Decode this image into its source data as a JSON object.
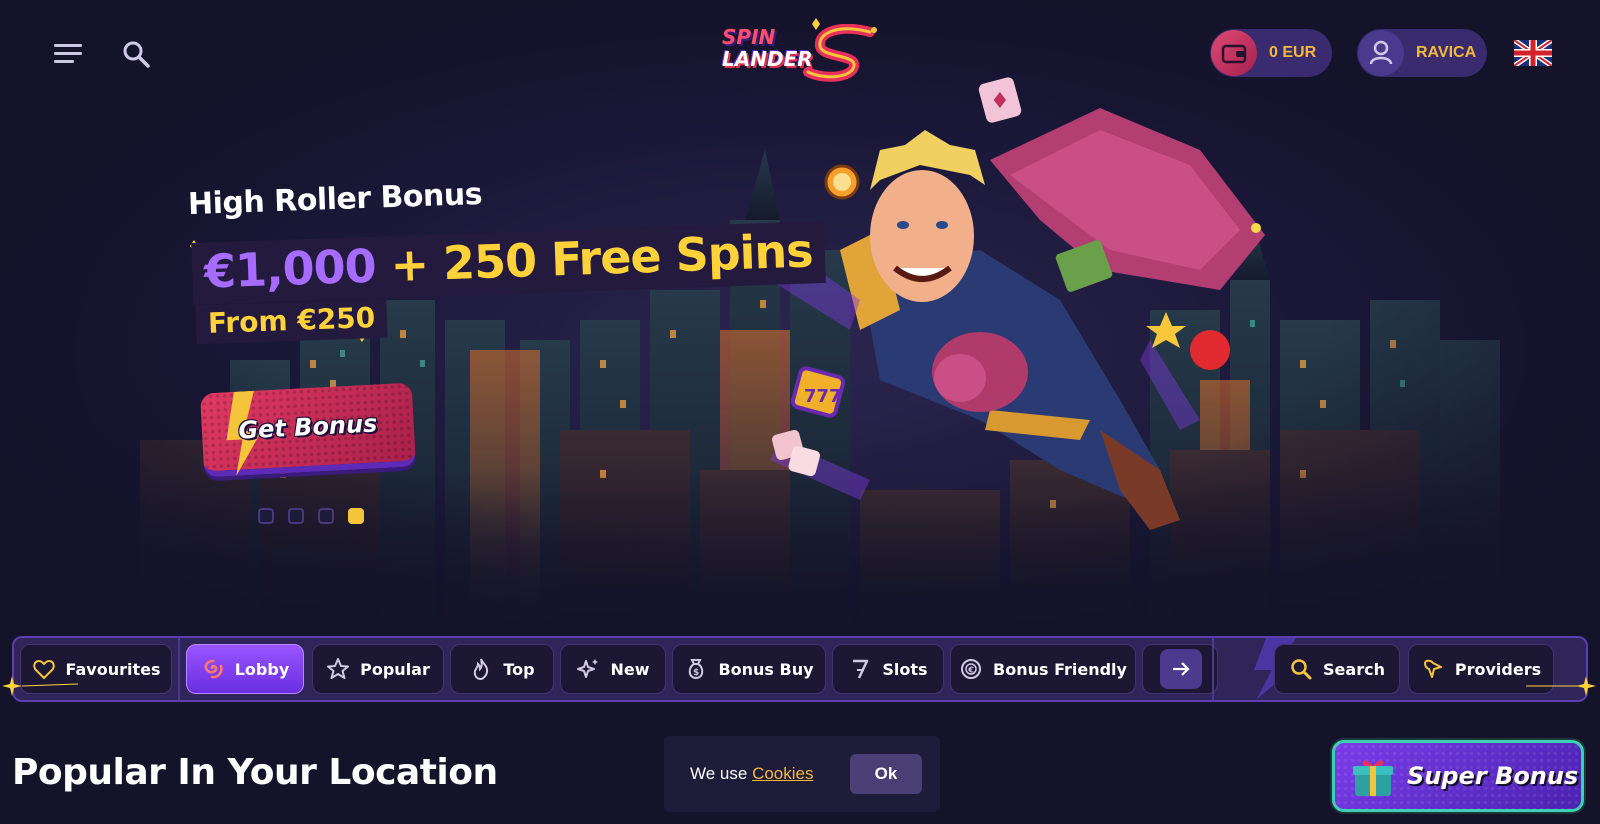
{
  "header": {
    "logo_line1": "SPIN",
    "logo_line2": "LANDER",
    "wallet_balance": "0 EUR",
    "username": "RAVICA",
    "language": "uk-flag"
  },
  "hero": {
    "title": "High Roller Bonus",
    "amount": "€1,000",
    "free_spins": "+ 250 Free Spins",
    "from": "From €250",
    "cta_label": "Get Bonus",
    "slides": 4,
    "active_slide": 4
  },
  "categories": [
    {
      "label": "Favourites",
      "icon": "heart-icon"
    },
    {
      "label": "Lobby",
      "icon": "spiral-icon",
      "active": true
    },
    {
      "label": "Popular",
      "icon": "star-icon"
    },
    {
      "label": "Top",
      "icon": "flame-icon"
    },
    {
      "label": "New",
      "icon": "sparkle-icon"
    },
    {
      "label": "Bonus Buy",
      "icon": "money-bag-icon"
    },
    {
      "label": "Slots",
      "icon": "seven-icon"
    },
    {
      "label": "Bonus Friendly",
      "icon": "coin-icon"
    }
  ],
  "actions": {
    "search_label": "Search",
    "providers_label": "Providers"
  },
  "main": {
    "section_title": "Popular In Your Location"
  },
  "cookie": {
    "text": "We use",
    "link": "Cookies",
    "ok": "Ok"
  },
  "super_bonus": {
    "label": "Super Bonus"
  },
  "colors": {
    "background": "#14132a",
    "accent_purple": "#a66bff",
    "accent_yellow": "#ffd23a",
    "accent_pink": "#e23a62",
    "teal": "#3fd0b4"
  }
}
